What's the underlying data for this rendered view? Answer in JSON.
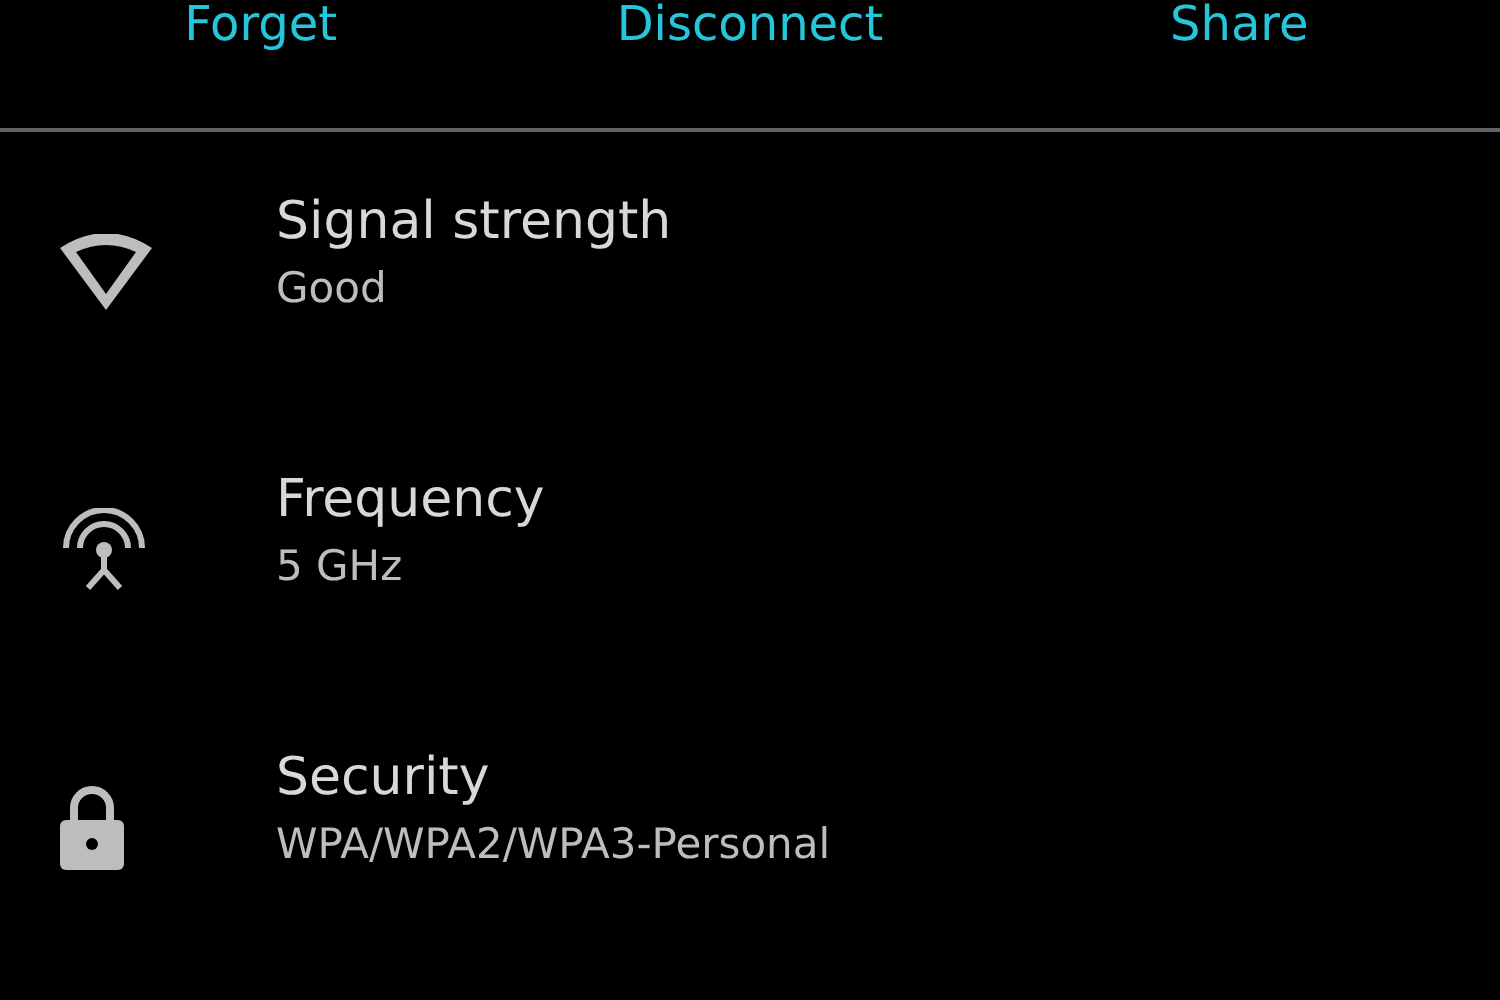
{
  "actions": [
    {
      "label": "Forget"
    },
    {
      "label": "Disconnect"
    },
    {
      "label": "Share"
    }
  ],
  "details": [
    {
      "kind": "signal",
      "title": "Signal strength",
      "value": "Good"
    },
    {
      "kind": "frequency",
      "title": "Frequency",
      "value": "5 GHz"
    },
    {
      "kind": "security",
      "title": "Security",
      "value": "WPA/WPA2/WPA3-Personal"
    }
  ]
}
